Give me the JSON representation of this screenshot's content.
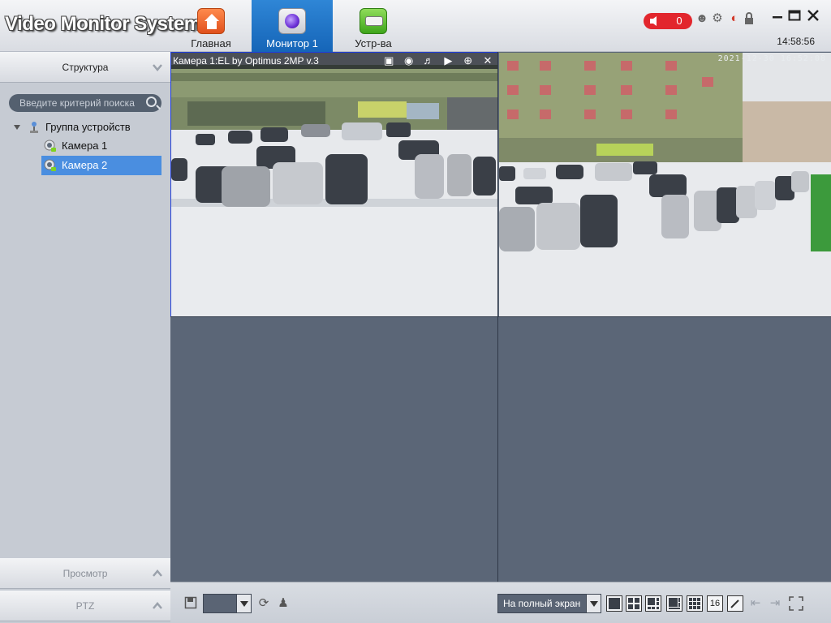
{
  "app": {
    "title": "Video Monitor System"
  },
  "nav": {
    "tabs": [
      {
        "label": "Главная",
        "icon": "home-icon"
      },
      {
        "label": "Монитор 1",
        "icon": "monitor-icon",
        "active": true
      },
      {
        "label": "Устр-ва",
        "icon": "device-icon"
      }
    ]
  },
  "status": {
    "alarm_count": "0",
    "clock": "14:58:56",
    "alarm_color": "#e2262d"
  },
  "sidebar": {
    "structure_label": "Структура",
    "search_placeholder": "Введите критерий поиска",
    "tree": {
      "group_label": "Группа устройств",
      "cameras": [
        {
          "label": "Камера 1",
          "selected": false
        },
        {
          "label": "Камера 2",
          "selected": true
        }
      ]
    },
    "preview_label": "Просмотр",
    "ptz_label": "PTZ"
  },
  "video": {
    "pane1": {
      "title": "Камера 1:EL by Optimus 2MP v.3"
    },
    "pane2": {
      "timestamp": "2021-12-30 16:52:08"
    }
  },
  "toolbar": {
    "fullscreen_select": "На полный экран",
    "layout_16_label": "16"
  },
  "colors": {
    "accent": "#1f6fc8",
    "selected_row": "#4a8ee0",
    "pane_border": "#1f3dd6"
  }
}
